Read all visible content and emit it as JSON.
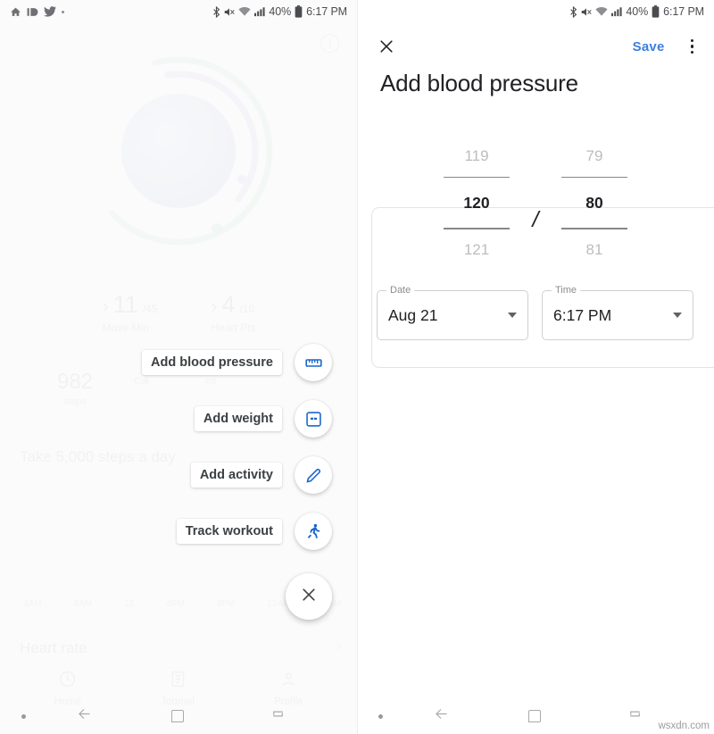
{
  "status_bar": {
    "left_icons": [
      "home-icon",
      "id-badge-icon",
      "twitter-icon",
      "dot-icon"
    ],
    "right_icons": [
      "bluetooth-icon",
      "mute-icon",
      "wifi-icon",
      "signal-icon",
      "battery-icon"
    ],
    "battery_pct": "40%",
    "time": "6:17 PM"
  },
  "left_panel": {
    "background_app": {
      "info_icon_label": "i",
      "stats": [
        {
          "chevron": "›",
          "value": "11",
          "unit": "/45",
          "label": "Move Min"
        },
        {
          "chevron": "›",
          "value": "4",
          "unit": "/10",
          "label": "Heart Pts"
        }
      ],
      "steps": {
        "value": "982",
        "label": "steps"
      },
      "mini_cells": [
        "Cal",
        "mi"
      ],
      "goal_text": "Take 5,000 steps a day",
      "axis_labels": [
        "4AM",
        "8AM",
        "12",
        "4PM",
        "8PM",
        "12AM",
        "4AM"
      ],
      "heart_rate_title": "Heart rate",
      "bottom_nav": [
        {
          "icon": "home-icon",
          "label": "Home"
        },
        {
          "icon": "journal-icon",
          "label": "Journal"
        },
        {
          "icon": "profile-icon",
          "label": "Profile"
        }
      ]
    },
    "speed_dial": {
      "items": [
        {
          "label": "Add blood pressure",
          "icon": "ruler-icon"
        },
        {
          "label": "Add weight",
          "icon": "scale-icon"
        },
        {
          "label": "Add activity",
          "icon": "pencil-icon"
        },
        {
          "label": "Track workout",
          "icon": "running-icon"
        }
      ],
      "close_icon": "close-icon"
    }
  },
  "right_panel": {
    "appbar": {
      "close_icon": "close-icon",
      "save_label": "Save",
      "overflow_icon": "more-vertical-icon"
    },
    "title": "Add blood pressure",
    "picker": {
      "systolic": {
        "prev": "119",
        "value": "120",
        "next": "121"
      },
      "separator": "/",
      "diastolic": {
        "prev": "79",
        "value": "80",
        "next": "81"
      }
    },
    "date_field": {
      "legend": "Date",
      "value": "Aug 21"
    },
    "time_field": {
      "legend": "Time",
      "value": "6:17 PM"
    }
  },
  "system_nav": {
    "icons": [
      "dot-icon",
      "back-icon",
      "home-square-icon",
      "recents-icon"
    ]
  },
  "watermark": "wsxdn.com",
  "colors": {
    "accent_blue": "#3d7fe0",
    "icon_blue": "#1a66c9",
    "text_primary": "#202124",
    "picker_ghost": "#bdbdbd"
  }
}
